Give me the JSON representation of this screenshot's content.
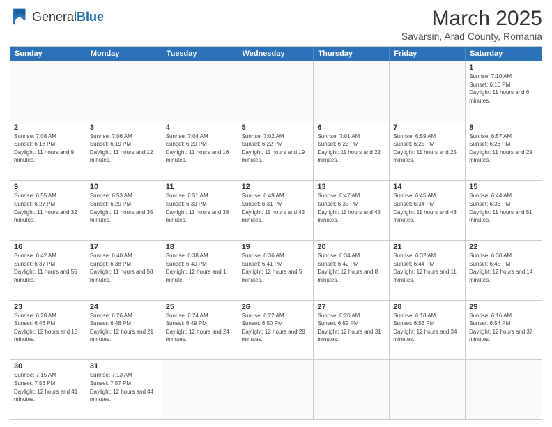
{
  "header": {
    "logo_general": "General",
    "logo_blue": "Blue",
    "title": "March 2025",
    "subtitle": "Savarsin, Arad County, Romania"
  },
  "weekdays": [
    "Sunday",
    "Monday",
    "Tuesday",
    "Wednesday",
    "Thursday",
    "Friday",
    "Saturday"
  ],
  "rows": [
    [
      {
        "day": "",
        "info": ""
      },
      {
        "day": "",
        "info": ""
      },
      {
        "day": "",
        "info": ""
      },
      {
        "day": "",
        "info": ""
      },
      {
        "day": "",
        "info": ""
      },
      {
        "day": "",
        "info": ""
      },
      {
        "day": "1",
        "info": "Sunrise: 7:10 AM\nSunset: 6:16 PM\nDaylight: 11 hours and 6 minutes."
      }
    ],
    [
      {
        "day": "2",
        "info": "Sunrise: 7:08 AM\nSunset: 6:18 PM\nDaylight: 11 hours and 9 minutes."
      },
      {
        "day": "3",
        "info": "Sunrise: 7:06 AM\nSunset: 6:19 PM\nDaylight: 11 hours and 12 minutes."
      },
      {
        "day": "4",
        "info": "Sunrise: 7:04 AM\nSunset: 6:20 PM\nDaylight: 11 hours and 16 minutes."
      },
      {
        "day": "5",
        "info": "Sunrise: 7:02 AM\nSunset: 6:22 PM\nDaylight: 11 hours and 19 minutes."
      },
      {
        "day": "6",
        "info": "Sunrise: 7:01 AM\nSunset: 6:23 PM\nDaylight: 11 hours and 22 minutes."
      },
      {
        "day": "7",
        "info": "Sunrise: 6:59 AM\nSunset: 6:25 PM\nDaylight: 11 hours and 25 minutes."
      },
      {
        "day": "8",
        "info": "Sunrise: 6:57 AM\nSunset: 6:26 PM\nDaylight: 11 hours and 29 minutes."
      }
    ],
    [
      {
        "day": "9",
        "info": "Sunrise: 6:55 AM\nSunset: 6:27 PM\nDaylight: 11 hours and 32 minutes."
      },
      {
        "day": "10",
        "info": "Sunrise: 6:53 AM\nSunset: 6:29 PM\nDaylight: 11 hours and 35 minutes."
      },
      {
        "day": "11",
        "info": "Sunrise: 6:51 AM\nSunset: 6:30 PM\nDaylight: 11 hours and 38 minutes."
      },
      {
        "day": "12",
        "info": "Sunrise: 6:49 AM\nSunset: 6:31 PM\nDaylight: 11 hours and 42 minutes."
      },
      {
        "day": "13",
        "info": "Sunrise: 6:47 AM\nSunset: 6:33 PM\nDaylight: 11 hours and 45 minutes."
      },
      {
        "day": "14",
        "info": "Sunrise: 6:45 AM\nSunset: 6:34 PM\nDaylight: 11 hours and 48 minutes."
      },
      {
        "day": "15",
        "info": "Sunrise: 6:44 AM\nSunset: 6:36 PM\nDaylight: 11 hours and 51 minutes."
      }
    ],
    [
      {
        "day": "16",
        "info": "Sunrise: 6:42 AM\nSunset: 6:37 PM\nDaylight: 11 hours and 55 minutes."
      },
      {
        "day": "17",
        "info": "Sunrise: 6:40 AM\nSunset: 6:38 PM\nDaylight: 11 hours and 58 minutes."
      },
      {
        "day": "18",
        "info": "Sunrise: 6:38 AM\nSunset: 6:40 PM\nDaylight: 12 hours and 1 minute."
      },
      {
        "day": "19",
        "info": "Sunrise: 6:36 AM\nSunset: 6:41 PM\nDaylight: 12 hours and 5 minutes."
      },
      {
        "day": "20",
        "info": "Sunrise: 6:34 AM\nSunset: 6:42 PM\nDaylight: 12 hours and 8 minutes."
      },
      {
        "day": "21",
        "info": "Sunrise: 6:32 AM\nSunset: 6:44 PM\nDaylight: 12 hours and 11 minutes."
      },
      {
        "day": "22",
        "info": "Sunrise: 6:30 AM\nSunset: 6:45 PM\nDaylight: 12 hours and 14 minutes."
      }
    ],
    [
      {
        "day": "23",
        "info": "Sunrise: 6:28 AM\nSunset: 6:46 PM\nDaylight: 12 hours and 18 minutes."
      },
      {
        "day": "24",
        "info": "Sunrise: 6:26 AM\nSunset: 6:48 PM\nDaylight: 12 hours and 21 minutes."
      },
      {
        "day": "25",
        "info": "Sunrise: 6:24 AM\nSunset: 6:49 PM\nDaylight: 12 hours and 24 minutes."
      },
      {
        "day": "26",
        "info": "Sunrise: 6:22 AM\nSunset: 6:50 PM\nDaylight: 12 hours and 28 minutes."
      },
      {
        "day": "27",
        "info": "Sunrise: 6:20 AM\nSunset: 6:52 PM\nDaylight: 12 hours and 31 minutes."
      },
      {
        "day": "28",
        "info": "Sunrise: 6:18 AM\nSunset: 6:53 PM\nDaylight: 12 hours and 34 minutes."
      },
      {
        "day": "29",
        "info": "Sunrise: 6:16 AM\nSunset: 6:54 PM\nDaylight: 12 hours and 37 minutes."
      }
    ],
    [
      {
        "day": "30",
        "info": "Sunrise: 7:15 AM\nSunset: 7:56 PM\nDaylight: 12 hours and 41 minutes."
      },
      {
        "day": "31",
        "info": "Sunrise: 7:13 AM\nSunset: 7:57 PM\nDaylight: 12 hours and 44 minutes."
      },
      {
        "day": "",
        "info": ""
      },
      {
        "day": "",
        "info": ""
      },
      {
        "day": "",
        "info": ""
      },
      {
        "day": "",
        "info": ""
      },
      {
        "day": "",
        "info": ""
      }
    ]
  ]
}
